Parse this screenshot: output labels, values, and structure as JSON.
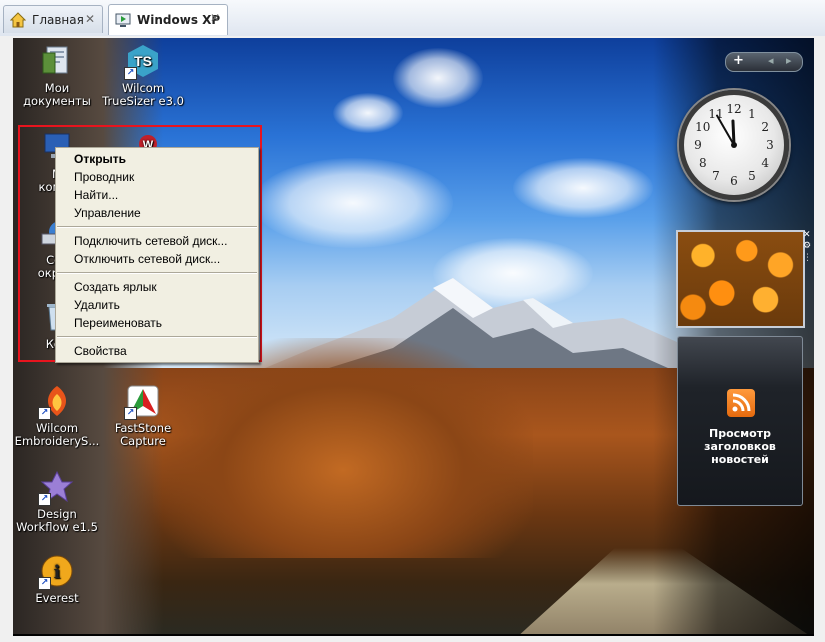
{
  "tabs": [
    {
      "label": "Главная",
      "icon": "home-icon",
      "active": false
    },
    {
      "label": "Windows XP",
      "icon": "vm-icon",
      "active": true
    }
  ],
  "desktop_icons": [
    {
      "label": "Мои документы",
      "line1": "Мои",
      "line2": "документы",
      "icon": "my-documents-icon"
    },
    {
      "label": "Wilcom TrueSizer e3.0",
      "line1": "Wilcom",
      "line2": "TrueSizer e3.0",
      "icon": "wilcom-truesizer-icon"
    },
    {
      "label": "Мо… компь…",
      "line1": "М",
      "line2": "компь",
      "icon": "my-computer-icon"
    },
    {
      "label": "Сет… окру…",
      "line1": "Сет",
      "line2": "окруж",
      "icon": "network-icon"
    },
    {
      "label": "Кор…",
      "line1": "Кор",
      "line2": "",
      "icon": "recycle-bin-icon"
    },
    {
      "label": "Wilcom EmbroiderySt…",
      "line1": "Wilcom",
      "line2": "EmbroideryS...",
      "icon": "wilcom-embroidery-icon"
    },
    {
      "label": "FastStone Capture",
      "line1": "FastStone",
      "line2": "Capture",
      "icon": "faststone-capture-icon"
    },
    {
      "label": "Design Workflow e1.5",
      "line1": "Design",
      "line2": "Workflow e1.5",
      "icon": "design-workflow-icon"
    },
    {
      "label": "Everest",
      "line1": "Everest",
      "line2": "",
      "icon": "everest-icon"
    }
  ],
  "context_menu": {
    "items": [
      {
        "label": "Открыть",
        "bold": true
      },
      {
        "label": "Проводник"
      },
      {
        "label": "Найти..."
      },
      {
        "label": "Управление"
      },
      {
        "label": "Подключить сетевой диск..."
      },
      {
        "label": "Отключить сетевой диск..."
      },
      {
        "label": "Создать ярлык"
      },
      {
        "label": "Удалить"
      },
      {
        "label": "Переименовать"
      },
      {
        "label": "Свойства"
      }
    ]
  },
  "sidebar": {
    "add_label": "+",
    "prev_label": "◂",
    "next_label": "▸"
  },
  "clock": {
    "time": "11:55",
    "numerals": [
      "12",
      "1",
      "2",
      "3",
      "4",
      "5",
      "6",
      "7",
      "8",
      "9",
      "10",
      "11"
    ]
  },
  "feed_gadget": {
    "title": "Просмотр заголовков новостей"
  },
  "colors": {
    "highlight": "#e8141e",
    "menu_bg": "#f1efe2"
  }
}
